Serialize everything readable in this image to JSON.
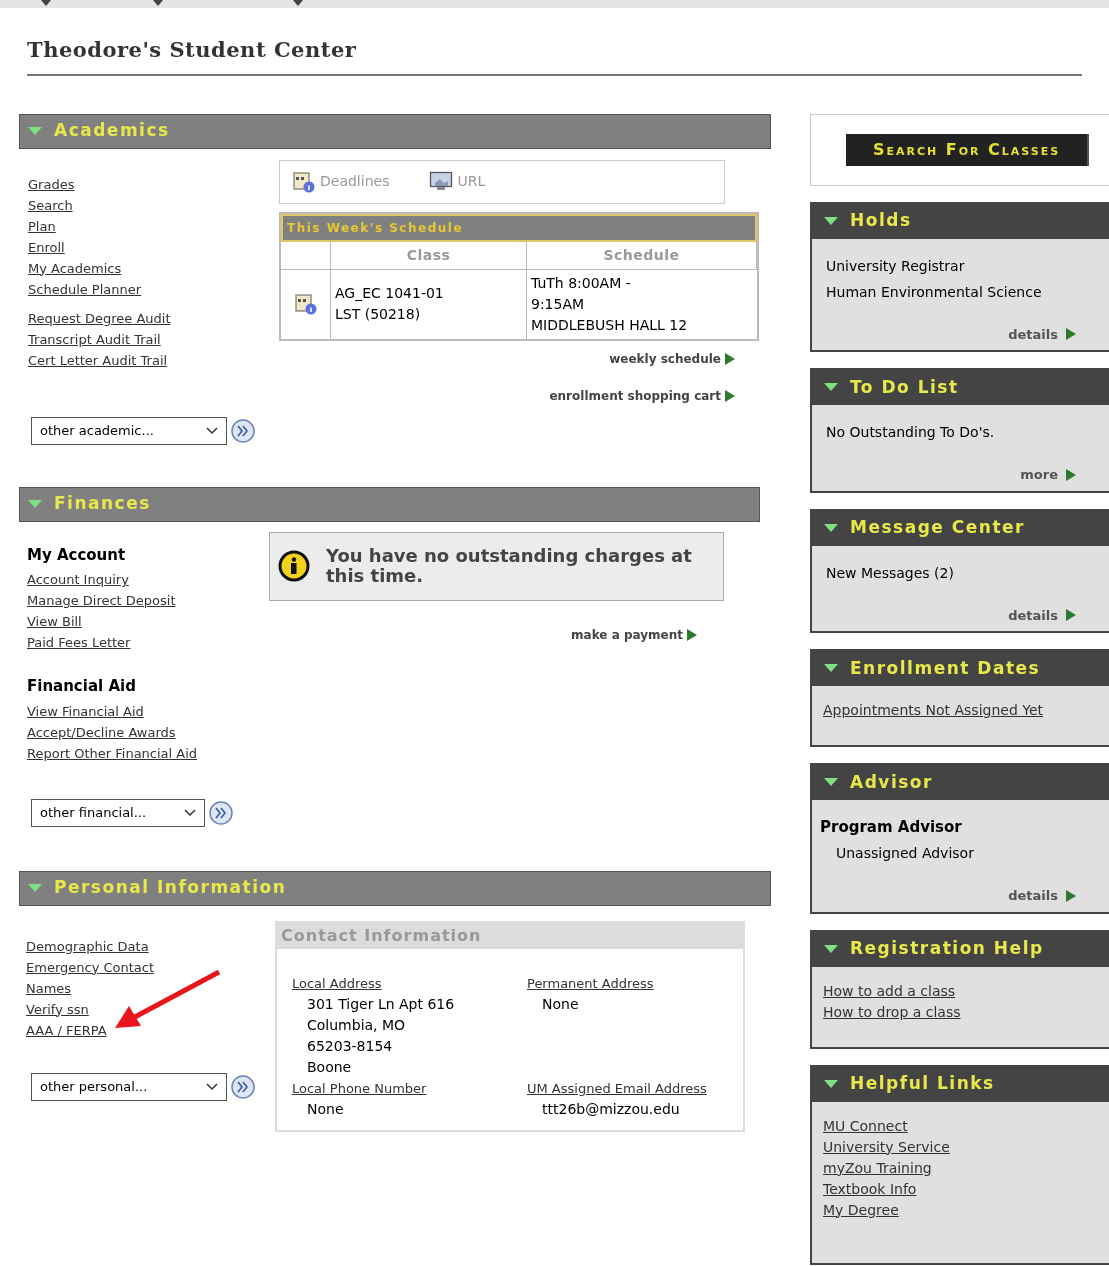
{
  "page_title": "Theodore's Student Center",
  "academics": {
    "title": "Academics",
    "link_groups": [
      [
        "Grades",
        "Search",
        "Plan",
        "Enroll",
        "My Academics",
        "Schedule Planner"
      ],
      [
        "Request Degree Audit",
        "Transcript Audit Trail",
        "Cert Letter Audit Trail"
      ]
    ],
    "dropdown": "other academic...",
    "toolbar": [
      {
        "kind": "deadlines",
        "label": "Deadlines"
      },
      {
        "kind": "url",
        "label": "URL"
      }
    ],
    "schedule": {
      "title": "This Week's Schedule",
      "columns": [
        "Class",
        "Schedule"
      ],
      "rows": [
        {
          "class_lines": [
            "AG_EC 1041-01",
            "LST (50218)"
          ],
          "schedule_lines": [
            "TuTh 8:00AM -",
            "9:15AM",
            "MIDDLEBUSH HALL 12"
          ]
        }
      ]
    },
    "links": [
      "weekly schedule",
      "enrollment shopping cart"
    ]
  },
  "finances": {
    "title": "Finances",
    "groups": [
      {
        "heading": "My Account",
        "links": [
          "Account Inquiry",
          "Manage Direct Deposit",
          "View Bill",
          "Paid Fees Letter"
        ]
      },
      {
        "heading": "Financial Aid",
        "links": [
          "View Financial Aid",
          "Accept/Decline Awards",
          "Report Other Financial Aid"
        ]
      }
    ],
    "dropdown": "other financial...",
    "notice": "You have no outstanding charges at this time.",
    "links": [
      "make a payment"
    ]
  },
  "personal": {
    "title": "Personal Information",
    "links": [
      "Demographic Data",
      "Emergency Contact",
      "Names",
      "Verify ssn",
      "AAA / FERPA"
    ],
    "dropdown": "other personal...",
    "contact": {
      "title": "Contact Information",
      "fields": [
        {
          "label": "Local Address",
          "lines": [
            "301 Tiger Ln Apt 616",
            "Columbia, MO",
            "65203-8154",
            "Boone"
          ]
        },
        {
          "label": "Permanent Address",
          "lines": [
            "None"
          ]
        },
        {
          "label": "Local Phone Number",
          "lines": [
            "None"
          ]
        },
        {
          "label": "UM Assigned Email Address",
          "lines": [
            "ttt26b@mizzou.edu"
          ]
        }
      ]
    }
  },
  "search_button": "Search For Classes",
  "panels": [
    {
      "title": "Holds",
      "items": [
        {
          "kind": "text",
          "text": "University Registrar"
        },
        {
          "kind": "text",
          "text": "Human Environmental Science"
        }
      ],
      "footer": "details"
    },
    {
      "title": "To Do List",
      "items": [
        {
          "kind": "text",
          "text": "No Outstanding To Do's."
        }
      ],
      "footer": "more"
    },
    {
      "title": "Message Center",
      "items": [
        {
          "kind": "text",
          "text": "New Messages (2)"
        }
      ],
      "footer": "details"
    },
    {
      "title": "Enrollment Dates",
      "items": [
        {
          "kind": "link",
          "text": "Appointments Not Assigned Yet"
        }
      ]
    },
    {
      "title": "Advisor",
      "items": [
        {
          "kind": "heading",
          "text": "Program Advisor"
        },
        {
          "kind": "text",
          "text": "Unassigned Advisor"
        }
      ],
      "footer": "details"
    },
    {
      "title": "Registration Help",
      "items": [
        {
          "kind": "link",
          "text": "How to add a class"
        },
        {
          "kind": "link",
          "text": "How to drop a class"
        }
      ]
    },
    {
      "title": "Helpful Links",
      "items": [
        {
          "kind": "link",
          "text": "MU Connect"
        },
        {
          "kind": "link",
          "text": "University Service"
        },
        {
          "kind": "link",
          "text": "myZou Training"
        },
        {
          "kind": "link",
          "text": "Textbook Info"
        },
        {
          "kind": "link",
          "text": "My Degree"
        }
      ]
    }
  ]
}
